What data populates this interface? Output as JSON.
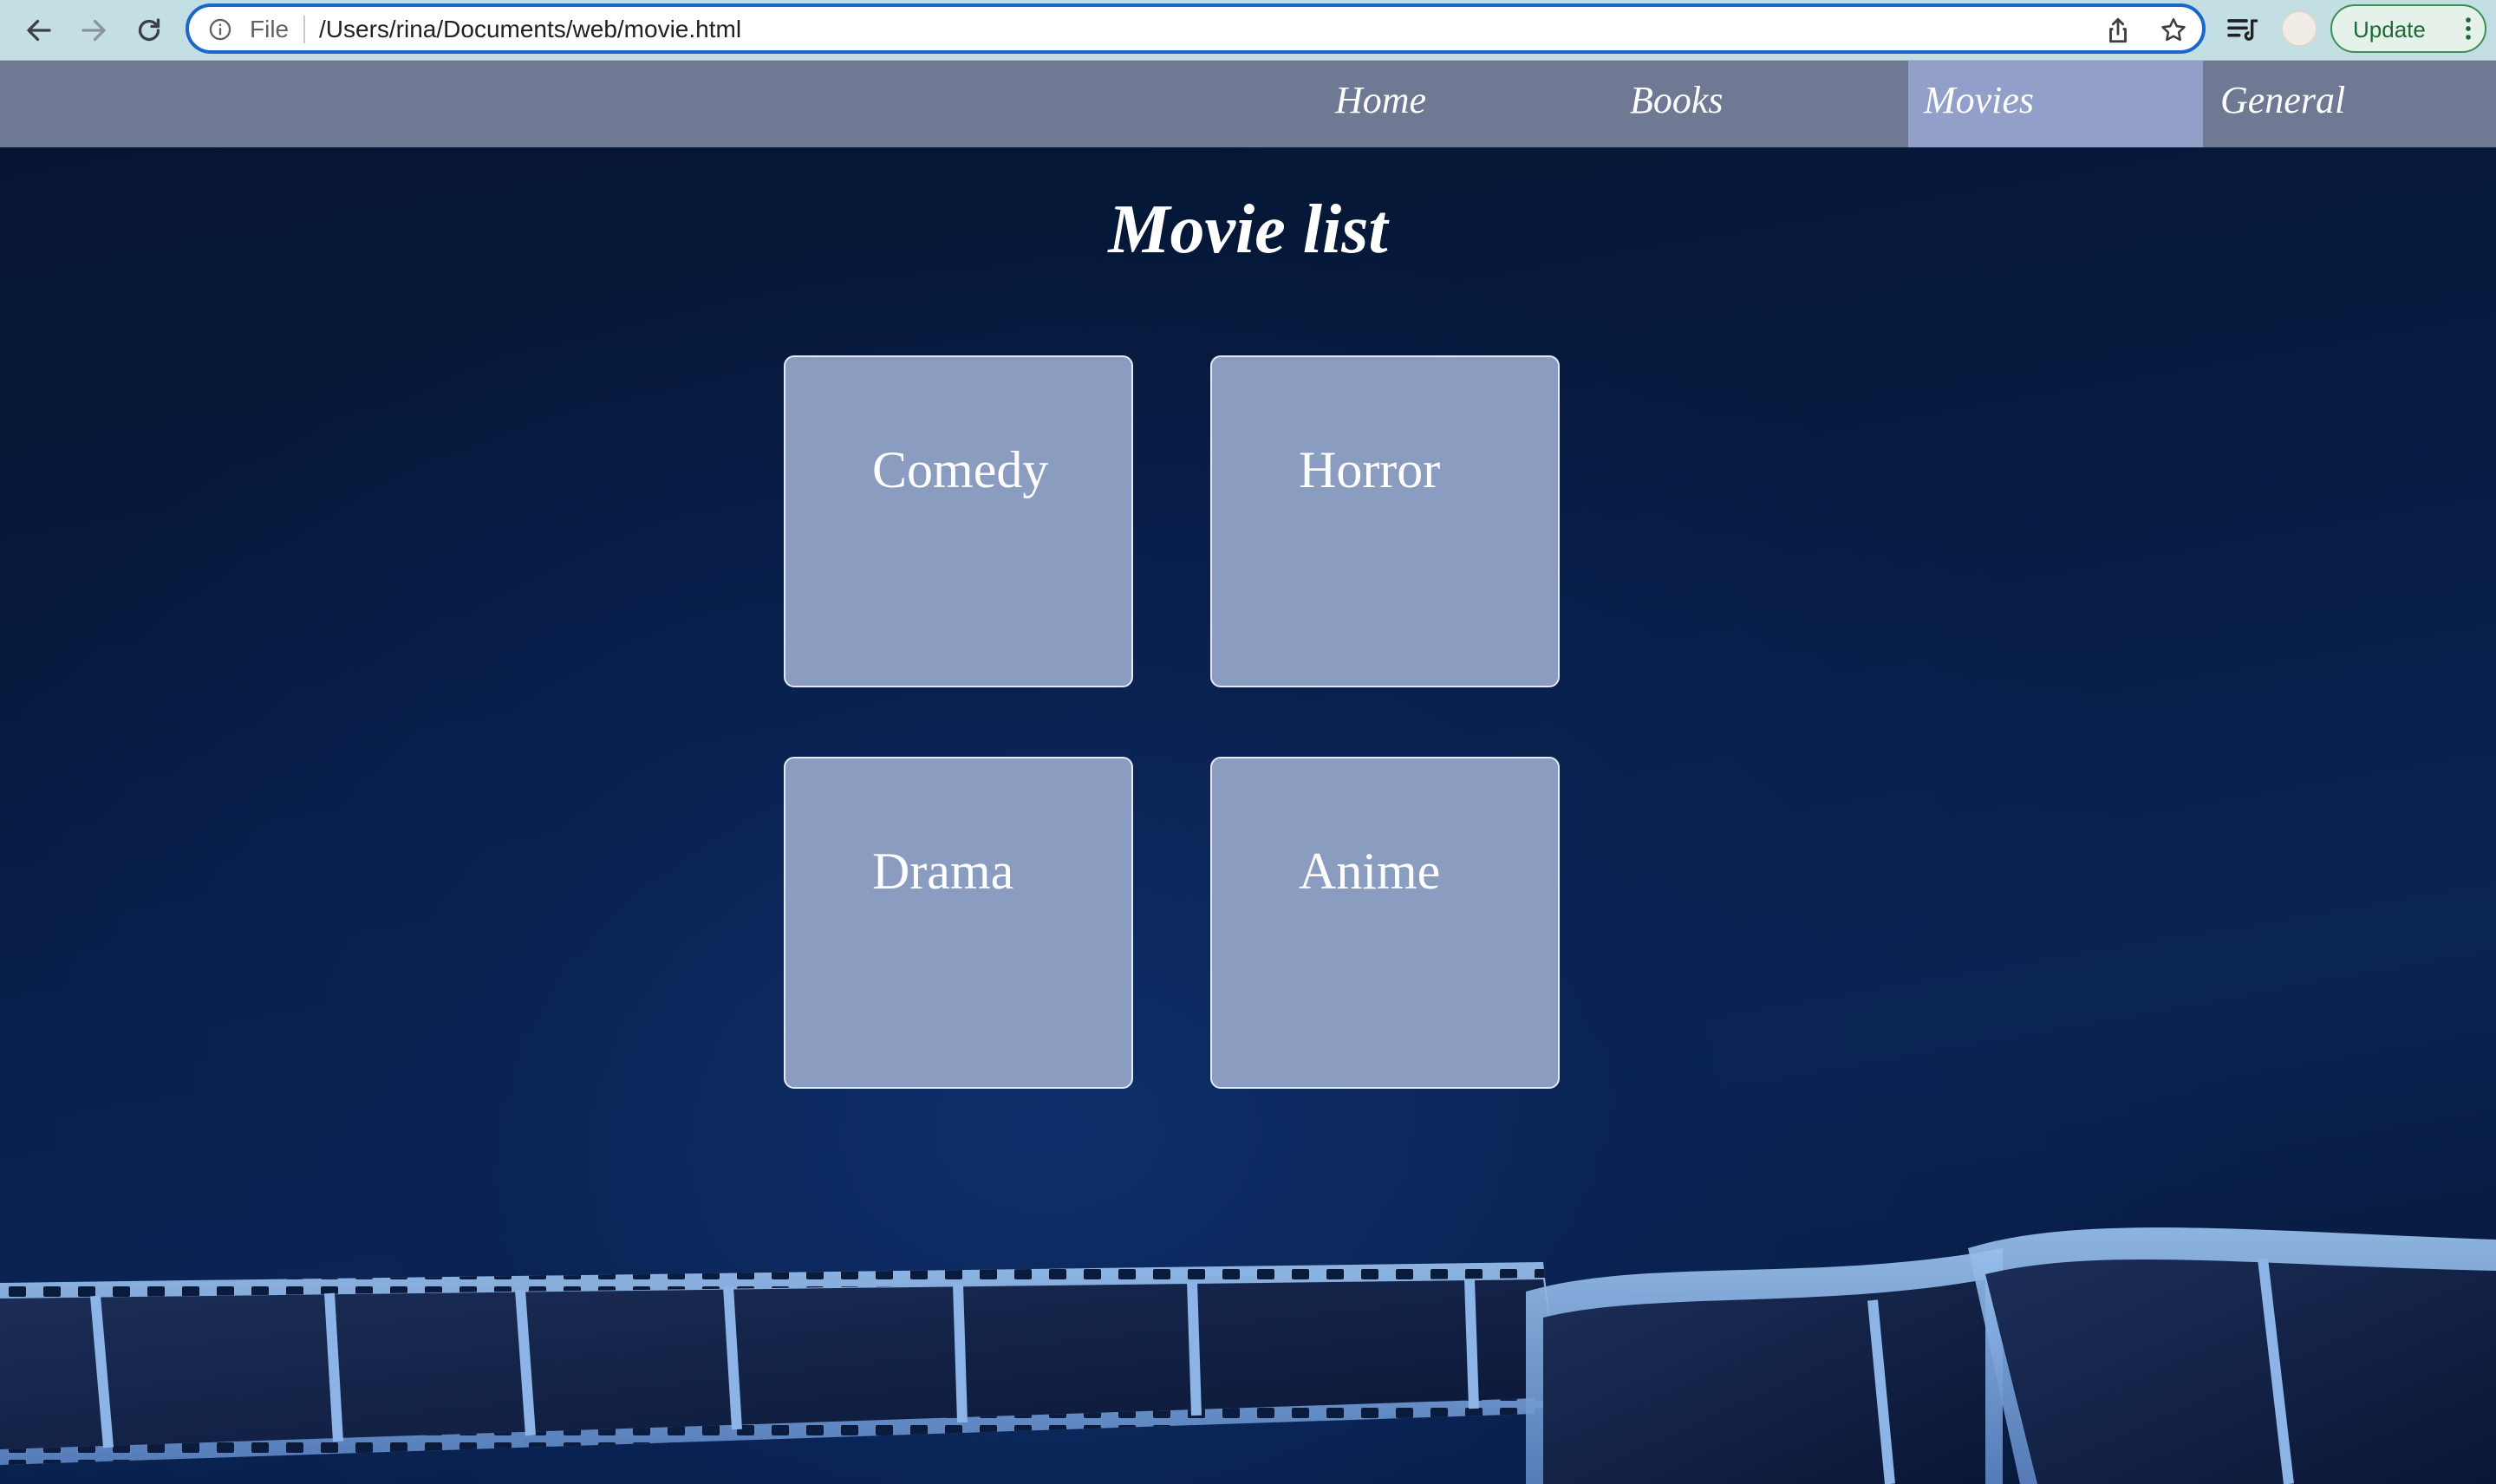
{
  "browser": {
    "site_info_label": "File",
    "url": "/Users/rina/Documents/web/movie.html",
    "update_label": "Update",
    "icons": [
      "back-icon",
      "forward-icon",
      "reload-icon",
      "info-icon",
      "share-icon",
      "star-icon",
      "reading-list-icon",
      "profile-avatar",
      "kebab-menu-icon"
    ]
  },
  "nav": {
    "items": [
      {
        "label": "Home"
      },
      {
        "label": "Books"
      },
      {
        "label": "Movies",
        "active": true
      },
      {
        "label": "General"
      }
    ]
  },
  "main": {
    "title": "Movie list",
    "categories": [
      {
        "label": "Comedy"
      },
      {
        "label": "Horror"
      },
      {
        "label": "Drama"
      },
      {
        "label": "Anime"
      }
    ]
  },
  "colors": {
    "nav_bar": "#6f7994",
    "nav_active": "#929fc8",
    "card_bg": "#8a9cbf",
    "page_bg": "#061a3e",
    "omnibox_border": "#1a66c9"
  }
}
